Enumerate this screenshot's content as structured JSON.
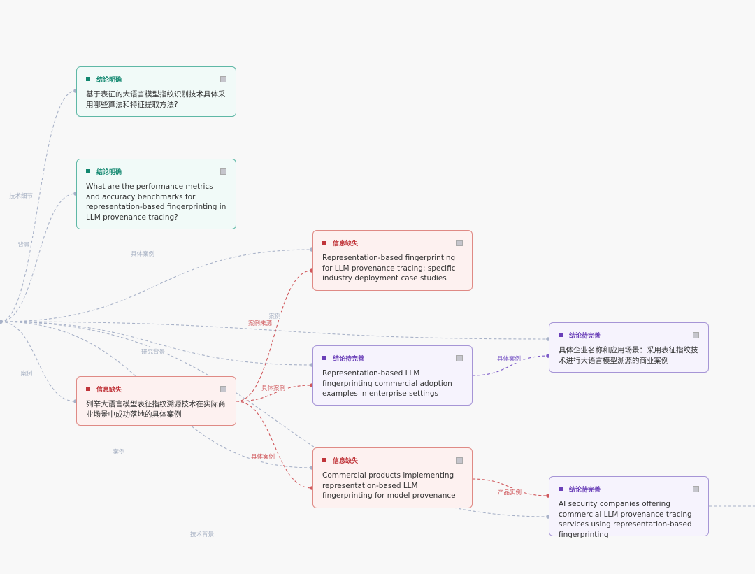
{
  "colors": {
    "teal": "#11876f",
    "red": "#c0353a",
    "purple": "#6a3fb8",
    "edge_gray": "#a8b2c8"
  },
  "nodes": [
    {
      "id": "n1",
      "status": "结论明确",
      "tone": "teal",
      "text": "基于表征的大语言模型指纹识别技术具体采用哪些算法和特征提取方法?"
    },
    {
      "id": "n2",
      "status": "结论明确",
      "tone": "teal",
      "text": "What are the performance metrics and accuracy benchmarks for representation-based fingerprinting in LLM provenance tracing?"
    },
    {
      "id": "n3",
      "status": "信息缺失",
      "tone": "red",
      "text": "Representation-based fingerprinting for LLM provenance tracing: specific industry deployment case studies"
    },
    {
      "id": "n4",
      "status": "结论待完善",
      "tone": "purple",
      "text": "Representation-based LLM fingerprinting commercial adoption examples in enterprise settings"
    },
    {
      "id": "n5",
      "status": "信息缺失",
      "tone": "red",
      "text": "列举大语言模型表征指纹溯源技术在实际商业场景中成功落地的具体案例"
    },
    {
      "id": "n6",
      "status": "信息缺失",
      "tone": "red",
      "text": "Commercial products implementing representation-based LLM fingerprinting for model provenance"
    },
    {
      "id": "n7",
      "status": "结论待完善",
      "tone": "purple",
      "text": "具体企业名称和应用场景：采用表征指纹技术进行大语言模型溯源的商业案例"
    },
    {
      "id": "n8",
      "status": "结论待完善",
      "tone": "purple",
      "text": "AI security companies offering commercial LLM provenance tracing services using representation-based fingerprinting"
    }
  ],
  "edges": [
    {
      "from": "root",
      "to": "n1",
      "label": "技术细节",
      "tone": "gray"
    },
    {
      "from": "root",
      "to": "n2",
      "label": "背景",
      "tone": "gray"
    },
    {
      "from": "root",
      "to": "n3",
      "label": "具体案例",
      "tone": "gray"
    },
    {
      "from": "root",
      "to": "n7",
      "label": "案例",
      "tone": "gray"
    },
    {
      "from": "root",
      "to": "n4",
      "label": "研究背景",
      "tone": "gray"
    },
    {
      "from": "root",
      "to": "n5",
      "label": "案例",
      "tone": "gray"
    },
    {
      "from": "root",
      "to": "n6",
      "label": "案例",
      "tone": "gray"
    },
    {
      "from": "root",
      "to": "n8",
      "label": "技术背景",
      "tone": "gray"
    },
    {
      "from": "n5",
      "to": "n3",
      "label": "案例来源",
      "tone": "red"
    },
    {
      "from": "n5",
      "to": "n4",
      "label": "具体案例",
      "tone": "red"
    },
    {
      "from": "n5",
      "to": "n6",
      "label": "具体案例",
      "tone": "red"
    },
    {
      "from": "n4",
      "to": "n7",
      "label": "具体案例",
      "tone": "purple"
    },
    {
      "from": "n6",
      "to": "n8",
      "label": "产品实例",
      "tone": "red"
    },
    {
      "from": "n8",
      "to": "offscreen",
      "label": "",
      "tone": "gray"
    }
  ]
}
